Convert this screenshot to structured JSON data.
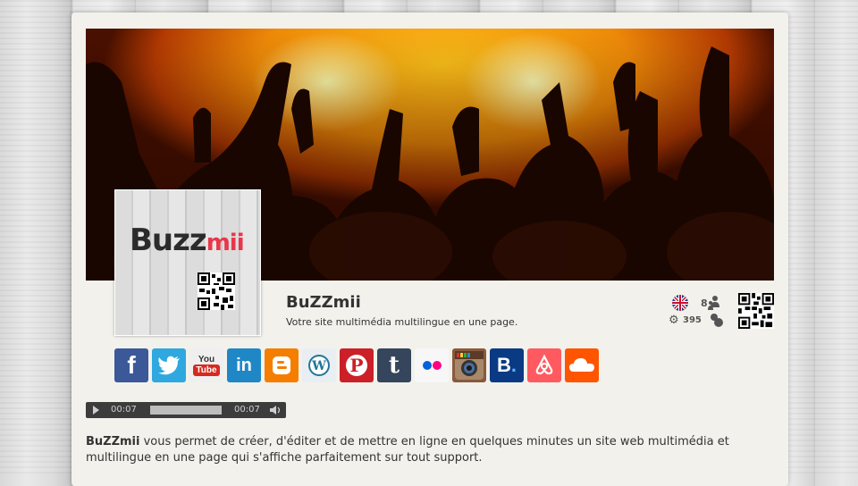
{
  "site": {
    "name": "BuZZmii",
    "tagline": "Votre site multimédia multilingue en une page."
  },
  "logo": {
    "text_main": "Buzz",
    "text_accent": "mii"
  },
  "stats": {
    "languages_count": "8",
    "views_count": "395",
    "flag": "uk-flag",
    "people_icon": "people-icon",
    "bubbles_icon": "bubbles-icon",
    "gear_icon": "gear-icon"
  },
  "social_links": [
    {
      "name": "facebook",
      "glyph": "f",
      "color": "#3b5998"
    },
    {
      "name": "twitter",
      "glyph": "🐦",
      "color": "#2fa8e0"
    },
    {
      "name": "youtube",
      "glyph": "You Tube",
      "color": "#efefef"
    },
    {
      "name": "linkedin",
      "glyph": "in",
      "color": "#1f87c6"
    },
    {
      "name": "blogger",
      "glyph": "B",
      "color": "#f57d00"
    },
    {
      "name": "wordpress",
      "glyph": "W",
      "color": "#e9eef2"
    },
    {
      "name": "pinterest",
      "glyph": "P",
      "color": "#cb2027"
    },
    {
      "name": "tumblr",
      "glyph": "t",
      "color": "#35465c"
    },
    {
      "name": "flickr",
      "glyph": "••",
      "color": "#f7f7f7"
    },
    {
      "name": "instagram",
      "glyph": "◉",
      "color": "#8a5a3c"
    },
    {
      "name": "booking",
      "glyph": "B.",
      "color": "#0b3a85"
    },
    {
      "name": "airbnb",
      "glyph": "⌂",
      "color": "#ff5a5f"
    },
    {
      "name": "soundcloud",
      "glyph": "☁",
      "color": "#ff5500"
    }
  ],
  "audio": {
    "current_time": "00:07",
    "total_time": "00:07",
    "progress": 1.0
  },
  "description": {
    "brand": "BuZZmii",
    "text": " vous permet de créer, d'éditer et de mettre en ligne en quelques minutes un site web multimédia et multilingue en une page qui s'affiche parfaitement sur tout support."
  }
}
